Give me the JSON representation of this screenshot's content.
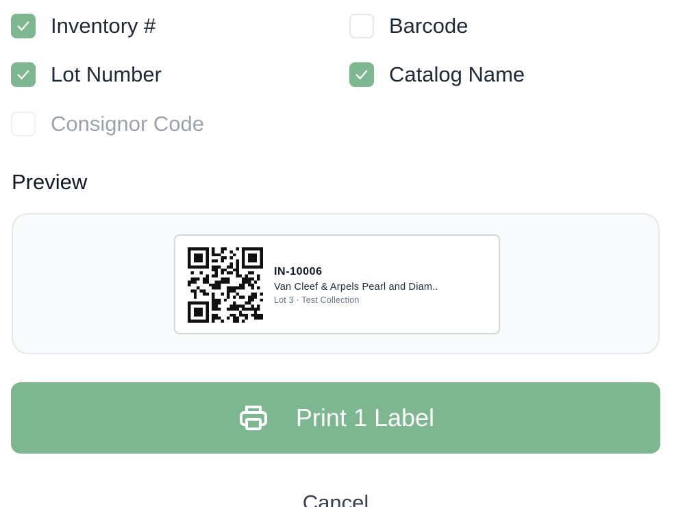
{
  "options": [
    {
      "label": "Inventory #",
      "checked": true
    },
    {
      "label": "Barcode",
      "checked": false
    },
    {
      "label": "Lot Number",
      "checked": true
    },
    {
      "label": "Catalog Name",
      "checked": true
    },
    {
      "label": "Consignor Code",
      "checked": false,
      "disabled": true
    }
  ],
  "preview": {
    "title": "Preview",
    "label_id": "IN-10006",
    "label_name": "Van Cleef & Arpels Pearl and Diam..",
    "label_sub": "Lot 3 · Test Collection"
  },
  "actions": {
    "print_label": "Print 1 Label",
    "cancel_label": "Cancel"
  },
  "icons": {
    "check": "check-icon",
    "print": "printer-icon",
    "qr": "qr-code"
  },
  "colors": {
    "accent": "#7cb78f",
    "text": "#1f2937",
    "muted": "#9ca3af",
    "preview_bg": "#f8fafc"
  }
}
